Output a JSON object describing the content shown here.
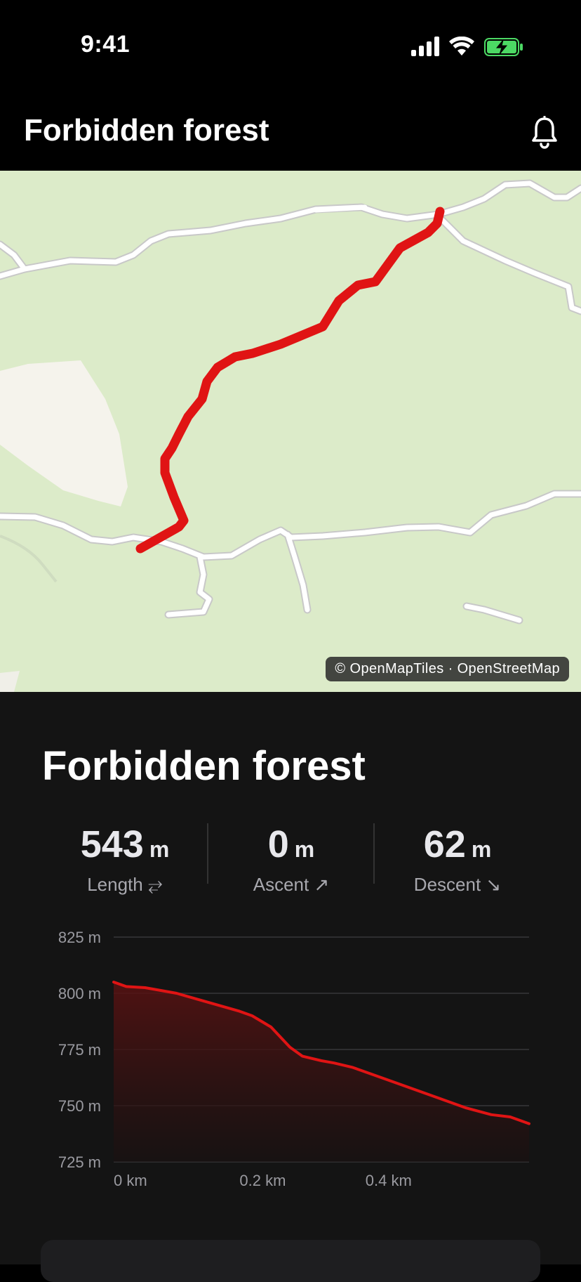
{
  "status_bar": {
    "time": "9:41"
  },
  "header": {
    "title": "Forbidden forest"
  },
  "map": {
    "attribution": "© OpenMapTiles · OpenStreetMap",
    "route_color": "#e01414"
  },
  "panel": {
    "title": "Forbidden forest",
    "stats": [
      {
        "value": "543",
        "unit": "m",
        "label": "Length ⥂"
      },
      {
        "value": "0",
        "unit": "m",
        "label": "Ascent ↗"
      },
      {
        "value": "62",
        "unit": "m",
        "label": "Descent ↘"
      }
    ]
  },
  "chart_data": {
    "type": "area",
    "y_ticks": [
      "825 m",
      "800 m",
      "775 m",
      "750 m",
      "725 m"
    ],
    "x_ticks": [
      "0 km",
      "0.2 km",
      "0.4 km"
    ],
    "ylim": [
      725,
      825
    ],
    "xlim": [
      0,
      0.66
    ],
    "series": [
      {
        "x": [
          0,
          0.02,
          0.05,
          0.1,
          0.15,
          0.2,
          0.22,
          0.25,
          0.28,
          0.3,
          0.33,
          0.35,
          0.38,
          0.42,
          0.47,
          0.52,
          0.56,
          0.6,
          0.63,
          0.66
        ],
        "y": [
          805,
          803,
          802.5,
          800,
          796,
          792,
          790,
          785,
          776,
          772,
          770,
          769,
          767,
          763,
          758,
          753,
          749,
          746,
          745,
          742
        ],
        "color": "#e01414"
      }
    ],
    "grid": true
  }
}
